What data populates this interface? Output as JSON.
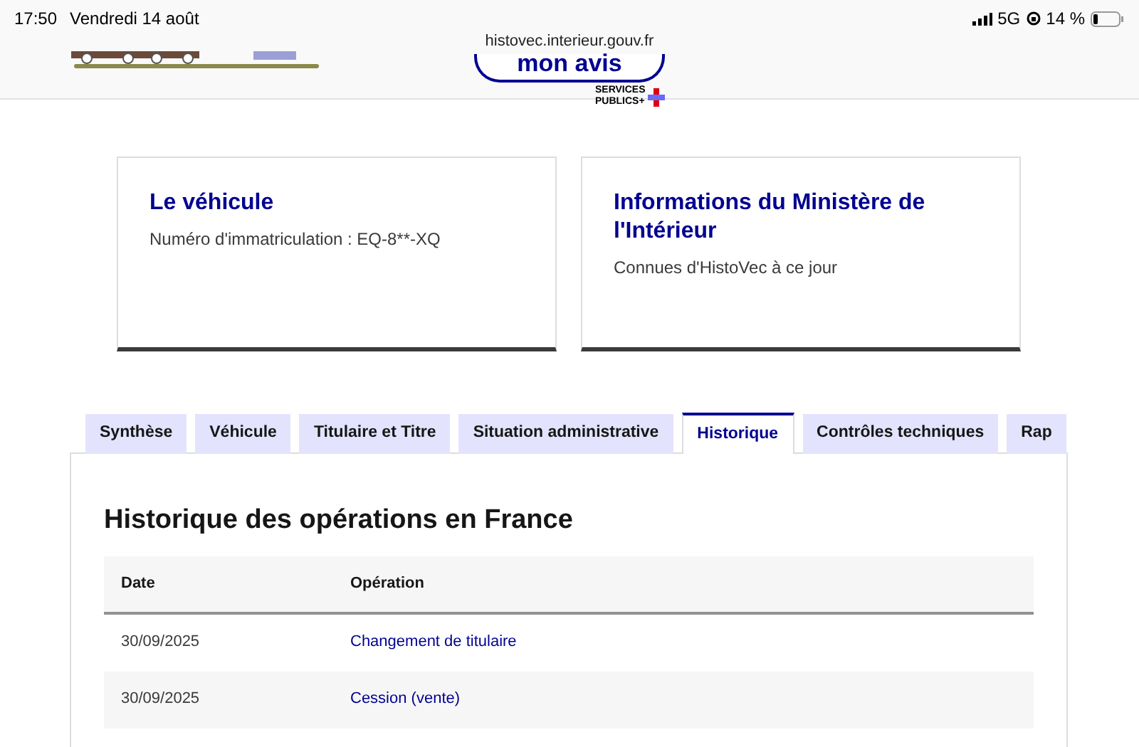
{
  "status_bar": {
    "time": "17:50",
    "date": "Vendredi 14 août",
    "network": "5G",
    "battery": "14 %",
    "url": "histovec.interieur.gouv.fr"
  },
  "header": {
    "feedback_button": "mon avis",
    "services_logo": [
      "SERVICES",
      "PUBLICS+"
    ]
  },
  "cards": [
    {
      "title": "Le véhicule",
      "text": "Numéro d'immatriculation : EQ-8**-XQ"
    },
    {
      "title": "Informations du Ministère de l'Intérieur",
      "text": "Connues d'HistoVec à ce jour"
    }
  ],
  "tabs": [
    {
      "label": "Synthèse",
      "selected": false
    },
    {
      "label": "Véhicule",
      "selected": false
    },
    {
      "label": "Titulaire et Titre",
      "selected": false
    },
    {
      "label": "Situation administrative",
      "selected": false
    },
    {
      "label": "Historique",
      "selected": true
    },
    {
      "label": "Contrôles techniques",
      "selected": false
    },
    {
      "label": "Rap",
      "selected": false
    }
  ],
  "section_title": "Historique des opérations en France",
  "table": {
    "columns": [
      "Date",
      "Opération"
    ],
    "rows": [
      {
        "date": "30/09/2025",
        "operation": "Changement de titulaire"
      },
      {
        "date": "30/09/2025",
        "operation": "Cession (vente)"
      }
    ]
  }
}
